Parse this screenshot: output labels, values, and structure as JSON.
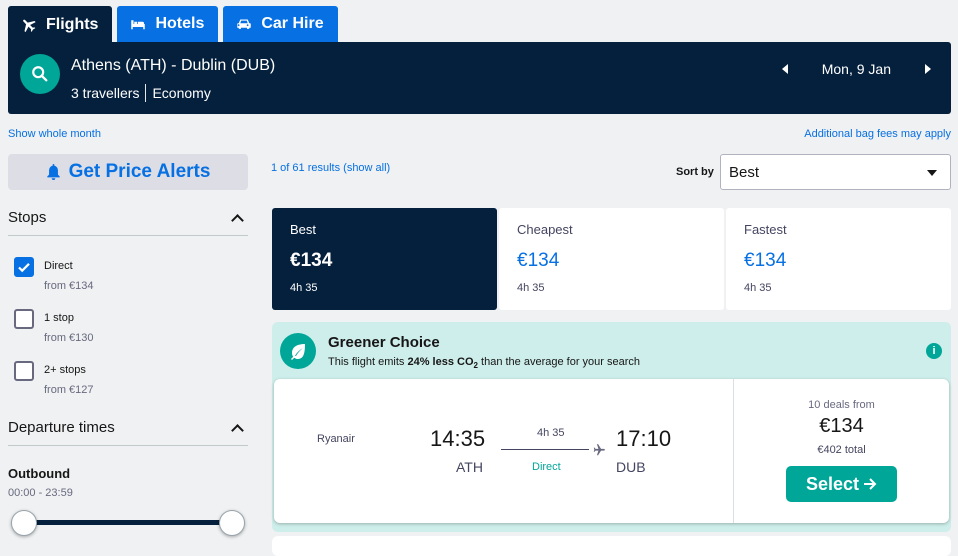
{
  "tabs": [
    {
      "label": "Flights",
      "icon": "plane-icon",
      "active": true
    },
    {
      "label": "Hotels",
      "icon": "bed-icon",
      "active": false
    },
    {
      "label": "Car Hire",
      "icon": "car-icon",
      "active": false
    }
  ],
  "search": {
    "route": "Athens (ATH) - Dublin (DUB)",
    "travellers": "3 travellers",
    "cabin": "Economy",
    "date": "Mon, 9 Jan"
  },
  "links": {
    "whole_month": "Show whole month",
    "bag_fees": "Additional bag fees may apply"
  },
  "alerts": {
    "label": "Get Price Alerts"
  },
  "filters": {
    "stops_title": "Stops",
    "stops": [
      {
        "label": "Direct",
        "price": "from €134",
        "checked": true
      },
      {
        "label": "1 stop",
        "price": "from €130",
        "checked": false
      },
      {
        "label": "2+ stops",
        "price": "from €127",
        "checked": false
      }
    ],
    "departure_title": "Departure times",
    "outbound_label": "Outbound",
    "outbound_range": "00:00 - 23:59"
  },
  "results": {
    "count_text": "1 of 61 results (show all)",
    "sort_label": "Sort by",
    "sort_value": "Best"
  },
  "sort_tabs": [
    {
      "name": "Best",
      "price": "€134",
      "duration": "4h 35",
      "active": true
    },
    {
      "name": "Cheapest",
      "price": "€134",
      "duration": "4h 35",
      "active": false
    },
    {
      "name": "Fastest",
      "price": "€134",
      "duration": "4h 35",
      "active": false
    }
  ],
  "greener": {
    "title": "Greener Choice",
    "sub_pre": "This flight emits ",
    "sub_bold": "24% less CO",
    "sub_sub": "2",
    "sub_post": " than the average for your search",
    "info": "i"
  },
  "flight": {
    "airline": "Ryanair",
    "dep_time": "14:35",
    "dep_code": "ATH",
    "duration": "4h 35",
    "stops": "Direct",
    "arr_time": "17:10",
    "arr_code": "DUB",
    "deals": "10 deals from",
    "price": "€134",
    "total": "€402 total",
    "select_label": "Select"
  },
  "colors": {
    "navy": "#05203c",
    "blue": "#0770e3",
    "teal": "#00a698",
    "green_bg": "#cdeeea"
  }
}
